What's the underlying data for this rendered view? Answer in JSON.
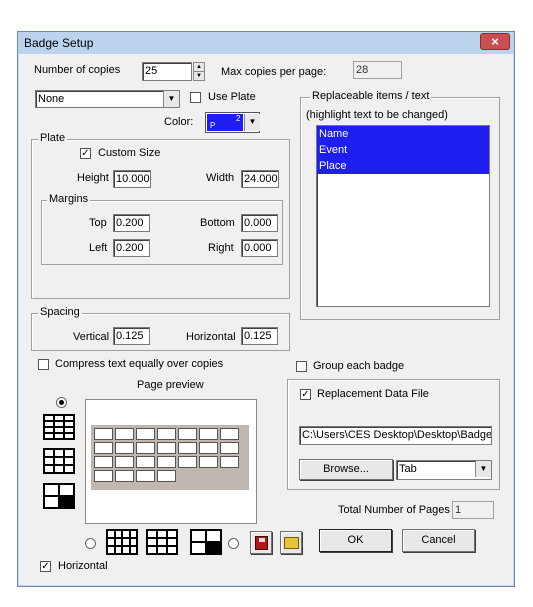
{
  "window": {
    "title": "Badge Setup",
    "close_label": "×"
  },
  "copies": {
    "label": "Number of copies",
    "value": "25",
    "max_label": "Max copies per page:",
    "max_value": "28"
  },
  "template_select": {
    "value": "None"
  },
  "use_plate": {
    "label": "Use Plate",
    "checked": false
  },
  "color": {
    "label": "Color:",
    "swatch_letter": "P",
    "swatch_number": "2",
    "swatch_color": "#1e1ef0"
  },
  "plate": {
    "legend": "Plate",
    "custom_size_label": "Custom Size",
    "height_label": "Height",
    "height_value": "10.000",
    "width_label": "Width",
    "width_value": "24.000",
    "margins": {
      "legend": "Margins",
      "top_label": "Top",
      "top_value": "0.200",
      "bottom_label": "Bottom",
      "bottom_value": "0.000",
      "left_label": "Left",
      "left_value": "0.200",
      "right_label": "Right",
      "right_value": "0.000"
    }
  },
  "replaceable": {
    "legend": "Replaceable items / text",
    "hint": "(highlight text to be changed)",
    "items": [
      "Name",
      "Event",
      "Place"
    ]
  },
  "spacing": {
    "legend": "Spacing",
    "vertical_label": "Vertical",
    "vertical_value": "0.125",
    "horizontal_label": "Horizontal",
    "horizontal_value": "0.125"
  },
  "compress_label": "Compress text equally over copies",
  "group_label": "Group each badge",
  "preview": {
    "label": "Page preview",
    "rows": 4,
    "cols": 7,
    "badges": 25
  },
  "data_file": {
    "label": "Replacement Data File",
    "path": "C:\\Users\\CES Desktop\\Desktop\\Badge",
    "browse_label": "Browse...",
    "delimiter": "Tab"
  },
  "total_pages": {
    "label": "Total Number of Pages",
    "value": "1"
  },
  "buttons": {
    "ok": "OK",
    "cancel": "Cancel"
  },
  "horizontal_label": "Horizontal",
  "colors": {
    "selection": "#1e1ef0",
    "titlebar": "#bcd3ee",
    "dialog_bg": "#f0f0f0"
  }
}
